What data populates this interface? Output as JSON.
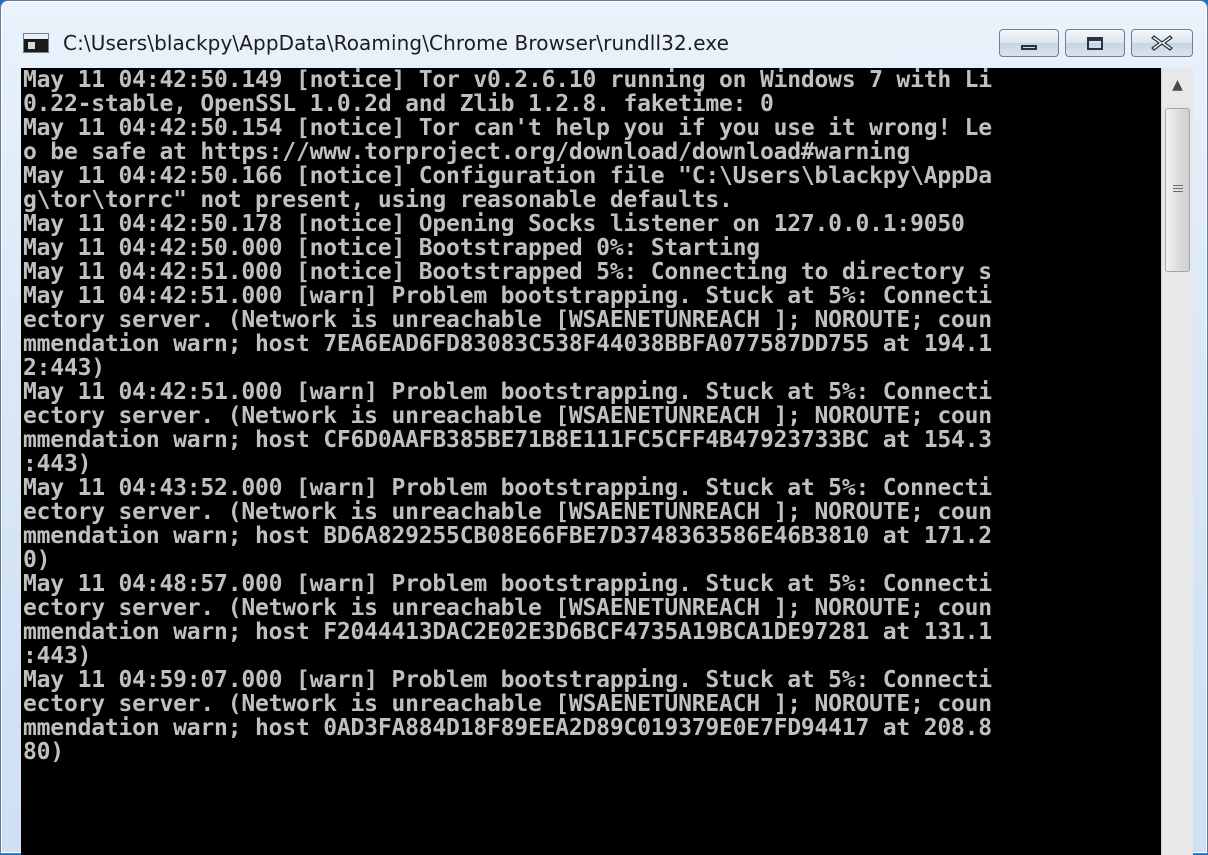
{
  "window": {
    "title": "C:\\Users\\blackpy\\AppData\\Roaming\\Chrome Browser\\rundll32.exe",
    "icon": "console-icon",
    "buttons": {
      "minimize": "minimize-icon",
      "maximize": "maximize-icon",
      "close": "close-icon"
    }
  },
  "console": {
    "lines": [
      "May 11 04:42:50.149 [notice] Tor v0.2.6.10 running on Windows 7 with Li",
      "0.22-stable, OpenSSL 1.0.2d and Zlib 1.2.8. faketime: 0",
      "May 11 04:42:50.154 [notice] Tor can't help you if you use it wrong! Le",
      "o be safe at https://www.torproject.org/download/download#warning",
      "May 11 04:42:50.166 [notice] Configuration file \"C:\\Users\\blackpy\\AppDa",
      "g\\tor\\torrc\" not present, using reasonable defaults.",
      "May 11 04:42:50.178 [notice] Opening Socks listener on 127.0.0.1:9050",
      "May 11 04:42:50.000 [notice] Bootstrapped 0%: Starting",
      "May 11 04:42:51.000 [notice] Bootstrapped 5%: Connecting to directory s",
      "May 11 04:42:51.000 [warn] Problem bootstrapping. Stuck at 5%: Connecti",
      "ectory server. (Network is unreachable [WSAENETUNREACH ]; NOROUTE; coun",
      "mmendation warn; host 7EA6EAD6FD83083C538F44038BBFA077587DD755 at 194.1",
      "2:443)",
      "May 11 04:42:51.000 [warn] Problem bootstrapping. Stuck at 5%: Connecti",
      "ectory server. (Network is unreachable [WSAENETUNREACH ]; NOROUTE; coun",
      "mmendation warn; host CF6D0AAFB385BE71B8E111FC5CFF4B47923733BC at 154.3",
      ":443)",
      "May 11 04:43:52.000 [warn] Problem bootstrapping. Stuck at 5%: Connecti",
      "ectory server. (Network is unreachable [WSAENETUNREACH ]; NOROUTE; coun",
      "mmendation warn; host BD6A829255CB08E66FBE7D3748363586E46B3810 at 171.2",
      "0)",
      "May 11 04:48:57.000 [warn] Problem bootstrapping. Stuck at 5%: Connecti",
      "ectory server. (Network is unreachable [WSAENETUNREACH ]; NOROUTE; coun",
      "mmendation warn; host F2044413DAC2E02E3D6BCF4735A19BCA1DE97281 at 131.1",
      ":443)",
      "May 11 04:59:07.000 [warn] Problem bootstrapping. Stuck at 5%: Connecti",
      "ectory server. (Network is unreachable [WSAENETUNREACH ]; NOROUTE; coun",
      "mmendation warn; host 0AD3FA884D18F89EEA2D89C019379E0E7FD94417 at 208.8",
      "80)"
    ]
  },
  "scrollbar": {
    "up_icon": "scroll-up-icon",
    "thumb_grip_icon": "grip-icon"
  }
}
